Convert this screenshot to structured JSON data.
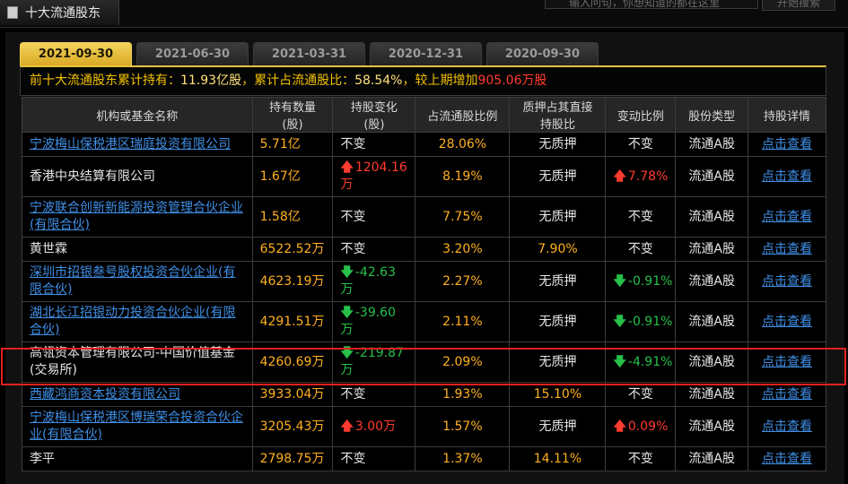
{
  "window": {
    "title": "十大流通股东",
    "search_placeholder": "输入问句，你想知道的都在这里",
    "search_button": "开始搜索"
  },
  "tabs": [
    {
      "label": "2021-09-30",
      "active": true
    },
    {
      "label": "2021-06-30",
      "active": false
    },
    {
      "label": "2021-03-31",
      "active": false
    },
    {
      "label": "2020-12-31",
      "active": false
    },
    {
      "label": "2020-09-30",
      "active": false
    }
  ],
  "summary": {
    "prefix": "前十大流通股东累计持有：",
    "total": "11.93亿股",
    "mid": "，累计占流通股比：",
    "ratio": "58.54%",
    "suffix": "，较上期增加",
    "increase": "905.06万股"
  },
  "table": {
    "headers": [
      "机构或基金名称",
      "持有数量(股)",
      "持股变化(股)",
      "占流通股比例",
      "质押占其直接持股比",
      "变动比例",
      "股份类型",
      "持股详情"
    ],
    "rows": [
      {
        "name": "宁波梅山保税港区瑞庭投资有限公司",
        "link": true,
        "qty": "5.71亿",
        "chg": "不变",
        "chg_dir": "none",
        "ratio": "28.06%",
        "pledge": "无质押",
        "vchg": "不变",
        "vchg_dir": "none",
        "type": "流通A股",
        "detail": "点击查看"
      },
      {
        "name": "香港中央结算有限公司",
        "link": false,
        "qty": "1.67亿",
        "chg": "1204.16万",
        "chg_dir": "up",
        "ratio": "8.19%",
        "pledge": "无质押",
        "vchg": "7.78%",
        "vchg_dir": "up",
        "type": "流通A股",
        "detail": "点击查看"
      },
      {
        "name": "宁波联合创新新能源投资管理合伙企业(有限合伙)",
        "link": true,
        "qty": "1.58亿",
        "chg": "不变",
        "chg_dir": "none",
        "ratio": "7.75%",
        "pledge": "无质押",
        "vchg": "不变",
        "vchg_dir": "none",
        "type": "流通A股",
        "detail": "点击查看"
      },
      {
        "name": "黄世霖",
        "link": false,
        "qty": "6522.52万",
        "chg": "不变",
        "chg_dir": "none",
        "ratio": "3.20%",
        "pledge": "7.90%",
        "vchg": "不变",
        "vchg_dir": "none",
        "type": "流通A股",
        "detail": "点击查看"
      },
      {
        "name": "深圳市招银叁号股权投资合伙企业(有限合伙)",
        "link": true,
        "qty": "4623.19万",
        "chg": "-42.63万",
        "chg_dir": "down",
        "ratio": "2.27%",
        "pledge": "无质押",
        "vchg": "-0.91%",
        "vchg_dir": "down",
        "type": "流通A股",
        "detail": "点击查看"
      },
      {
        "name": "湖北长江招银动力投资合伙企业(有限合伙)",
        "link": true,
        "qty": "4291.51万",
        "chg": "-39.60万",
        "chg_dir": "down",
        "ratio": "2.11%",
        "pledge": "无质押",
        "vchg": "-0.91%",
        "vchg_dir": "down",
        "type": "流通A股",
        "detail": "点击查看"
      },
      {
        "name": "高瓴资本管理有限公司-中国价值基金(交易所)",
        "link": false,
        "qty": "4260.69万",
        "chg": "-219.87万",
        "chg_dir": "down",
        "ratio": "2.09%",
        "pledge": "无质押",
        "vchg": "-4.91%",
        "vchg_dir": "down",
        "type": "流通A股",
        "detail": "点击查看"
      },
      {
        "name": "西藏鸿商资本投资有限公司",
        "link": true,
        "qty": "3933.04万",
        "chg": "不变",
        "chg_dir": "none",
        "ratio": "1.93%",
        "pledge": "15.10%",
        "vchg": "不变",
        "vchg_dir": "none",
        "type": "流通A股",
        "detail": "点击查看"
      },
      {
        "name": "宁波梅山保税港区博瑞荣合投资合伙企业(有限合伙)",
        "link": true,
        "qty": "3205.43万",
        "chg": "3.00万",
        "chg_dir": "up",
        "ratio": "1.57%",
        "pledge": "无质押",
        "vchg": "0.09%",
        "vchg_dir": "up",
        "type": "流通A股",
        "detail": "点击查看"
      },
      {
        "name": "李平",
        "link": false,
        "qty": "2798.75万",
        "chg": "不变",
        "chg_dir": "none",
        "ratio": "1.37%",
        "pledge": "14.11%",
        "vchg": "不变",
        "vchg_dir": "none",
        "type": "流通A股",
        "detail": "点击查看"
      }
    ]
  },
  "colors": {
    "accent": "#e8c23f",
    "rise": "#ff3b2f",
    "fall": "#27c04a",
    "link": "#3f8fe6",
    "number": "#ffb020",
    "highlight_border": "#e32020"
  },
  "icons": {
    "up": "arrow-up-icon",
    "down": "arrow-down-icon"
  }
}
